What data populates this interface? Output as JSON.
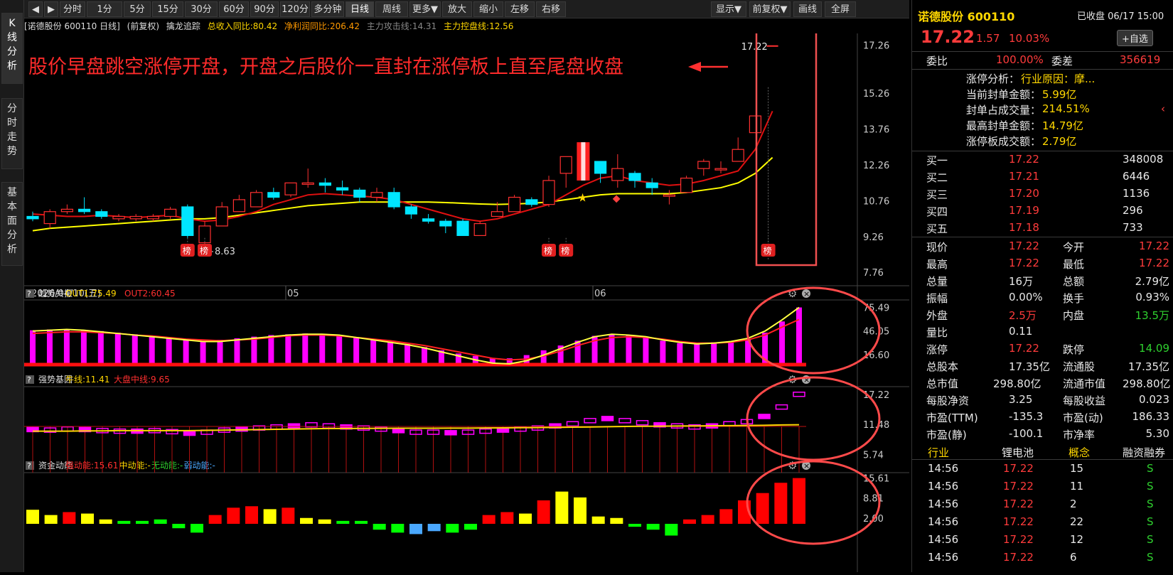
{
  "left_tabs": [
    "K线分析",
    "分时走势",
    "基本面分析"
  ],
  "toolbar": {
    "buttons": [
      "分时",
      "1分",
      "5分",
      "15分",
      "30分",
      "60分",
      "90分",
      "120分",
      "多分钟",
      "日线",
      "周线",
      "更多▼",
      "放大",
      "缩小",
      "左移",
      "右移"
    ],
    "selected": "日线",
    "right_buttons": [
      "显示▼",
      "前复权▼",
      "画线",
      "全屏"
    ]
  },
  "chart_header": {
    "title": "[诺德股份 600110 日线]",
    "adjust": "(前复权)",
    "indicator": "擒龙追踪",
    "rev": "总收入同比:80.42",
    "profit": "净利润同比:206.42",
    "attack": "主力攻击线:14.31",
    "control": "主力控盘线:12.56"
  },
  "annotation": "股价早盘跳空涨停开盘，开盘之后股价一直封在涨停板上直至尾盘收盘",
  "price_axis": [
    "17.26",
    "15.26",
    "13.76",
    "12.26",
    "10.76",
    "9.26",
    "7.76"
  ],
  "date_axis": [
    "2026/04/10(五)",
    "05",
    "06"
  ],
  "last_price_label": "17.22",
  "low_label": "8.63",
  "bang": "榜",
  "panel1": {
    "name": "趋势共振",
    "out1": "OUT1:75.49",
    "out2": "OUT2:60.45",
    "ticks": [
      "75.49",
      "46.05",
      "16.60"
    ]
  },
  "panel2": {
    "name": "强势基因",
    "l1": "牛线:11.41",
    "l2": "大盘中线:9.65",
    "ticks": [
      "17.22",
      "11.48",
      "5.74"
    ]
  },
  "panel3": {
    "name": "资金动能",
    "l1": "强动能:15.61",
    "l2": "中动能:-",
    "l3": "无动能:-",
    "l4": "弱动能:-",
    "ticks": [
      "15.61",
      "8.81",
      "2.00"
    ]
  },
  "chart_data": {
    "type": "candlestick",
    "candles": [
      [
        10.1,
        10.0,
        10.3,
        9.9
      ],
      [
        9.8,
        10.3,
        10.4,
        9.6
      ],
      [
        10.3,
        10.4,
        10.6,
        10.2
      ],
      [
        10.4,
        10.3,
        10.9,
        10.2
      ],
      [
        10.3,
        10.1,
        10.4,
        10.0
      ],
      [
        10.0,
        10.1,
        10.2,
        9.9
      ],
      [
        10.0,
        10.1,
        10.2,
        9.9
      ],
      [
        10.0,
        10.1,
        10.2,
        9.9
      ],
      [
        10.1,
        10.4,
        10.5,
        10.0
      ],
      [
        10.5,
        9.3,
        10.6,
        9.2
      ],
      [
        9.0,
        9.7,
        9.9,
        8.63
      ],
      [
        9.7,
        10.5,
        10.7,
        9.7
      ],
      [
        10.3,
        10.8,
        11.0,
        10.3
      ],
      [
        10.5,
        11.1,
        11.2,
        10.5
      ],
      [
        11.1,
        10.9,
        11.3,
        10.8
      ],
      [
        11.0,
        11.5,
        11.5,
        10.9
      ],
      [
        11.5,
        11.5,
        12.1,
        11.3
      ],
      [
        11.5,
        11.4,
        11.7,
        11.1
      ],
      [
        11.3,
        11.2,
        11.6,
        11.0
      ],
      [
        11.2,
        10.9,
        11.3,
        10.7
      ],
      [
        10.9,
        11.1,
        11.3,
        10.7
      ],
      [
        11.1,
        10.5,
        11.3,
        10.4
      ],
      [
        10.5,
        10.2,
        10.6,
        10.0
      ],
      [
        10.0,
        9.9,
        10.2,
        9.8
      ],
      [
        9.9,
        9.7,
        10.0,
        9.4
      ],
      [
        9.9,
        9.3,
        10.0,
        9.3
      ],
      [
        9.3,
        9.8,
        9.9,
        9.3
      ],
      [
        10.1,
        10.3,
        10.7,
        10.1
      ],
      [
        10.3,
        10.9,
        11.0,
        10.3
      ],
      [
        10.8,
        10.6,
        10.9,
        10.5
      ],
      [
        10.6,
        11.6,
        11.8,
        10.5
      ],
      [
        11.9,
        12.6,
        12.6,
        11.3
      ],
      [
        12.7,
        12.4,
        13.1,
        12.3
      ],
      [
        12.4,
        11.9,
        12.4,
        11.5
      ],
      [
        11.6,
        12.1,
        12.7,
        11.3
      ],
      [
        11.9,
        11.6,
        12.0,
        11.3
      ],
      [
        11.5,
        11.3,
        11.7,
        11.0
      ],
      [
        11.0,
        11.0,
        11.2,
        10.6
      ],
      [
        11.1,
        11.7,
        11.8,
        11.1
      ],
      [
        12.1,
        12.4,
        12.5,
        11.8
      ],
      [
        12.1,
        12.1,
        12.4,
        11.9
      ],
      [
        12.4,
        12.9,
        13.4,
        12.4
      ],
      [
        13.6,
        14.3,
        14.3,
        13.6
      ],
      [
        17.22,
        17.22,
        17.22,
        17.22
      ]
    ],
    "ma_red": [
      10.2,
      10.15,
      10.1,
      10.1,
      10.15,
      10.1,
      10.05,
      10.1,
      10.15,
      10.0,
      9.9,
      9.95,
      10.1,
      10.3,
      10.6,
      10.8,
      11.0,
      11.05,
      11.0,
      10.95,
      10.9,
      10.8,
      10.6,
      10.4,
      10.2,
      10.0,
      9.9,
      10.0,
      10.2,
      10.4,
      10.6,
      11.0,
      11.4,
      11.7,
      11.8,
      11.6,
      11.5,
      11.4,
      11.45,
      11.6,
      11.8,
      12.0,
      12.9,
      14.5
    ],
    "ma_yellow": [
      9.5,
      9.6,
      9.65,
      9.7,
      9.75,
      9.8,
      9.85,
      9.9,
      9.95,
      10.0,
      10.0,
      10.05,
      10.15,
      10.25,
      10.35,
      10.45,
      10.55,
      10.6,
      10.65,
      10.7,
      10.7,
      10.7,
      10.7,
      10.7,
      10.68,
      10.65,
      10.62,
      10.6,
      10.62,
      10.65,
      10.7,
      10.8,
      10.9,
      11.0,
      11.05,
      11.05,
      11.05,
      11.05,
      11.1,
      11.2,
      11.3,
      11.5,
      11.9,
      12.56
    ],
    "osc_bars": [
      47,
      48,
      48,
      47,
      46,
      44,
      42,
      40,
      38,
      36,
      34,
      35,
      37,
      39,
      41,
      42,
      43,
      42,
      40,
      38,
      36,
      33,
      30,
      26,
      22,
      18,
      15,
      12,
      12,
      16,
      22,
      28,
      34,
      40,
      42,
      41,
      38,
      34,
      31,
      31,
      32,
      33,
      36,
      44,
      58,
      75.49
    ],
    "osc_out1": [
      46,
      47,
      48,
      47,
      45,
      43,
      41,
      39,
      37,
      35,
      33,
      33,
      35,
      37,
      39,
      41,
      42,
      42,
      41,
      38,
      35,
      32,
      29,
      25,
      20,
      15,
      10,
      6,
      5,
      9,
      16,
      24,
      32,
      39,
      42,
      41,
      39,
      35,
      32,
      30,
      31,
      33,
      37,
      46,
      60,
      75.49
    ],
    "osc_out2": [
      43,
      44,
      45,
      45,
      44,
      43,
      41,
      40,
      38,
      36,
      35,
      34,
      35,
      36,
      38,
      40,
      41,
      41,
      40,
      38,
      36,
      34,
      31,
      28,
      24,
      20,
      16,
      12,
      10,
      11,
      15,
      21,
      28,
      34,
      38,
      39,
      38,
      36,
      33,
      31,
      31,
      32,
      35,
      41,
      51,
      60.45
    ],
    "gene_vals": [
      10.5,
      10.4,
      10.6,
      10.5,
      10.3,
      10.2,
      10.2,
      10.3,
      10.1,
      9.8,
      10.0,
      10.4,
      10.6,
      10.8,
      11.0,
      11.2,
      11.4,
      11.2,
      11.0,
      10.8,
      10.6,
      10.3,
      10.0,
      10.0,
      9.9,
      10.0,
      10.2,
      10.4,
      10.6,
      10.8,
      11.2,
      11.6,
      12.2,
      12.6,
      12.2,
      11.8,
      11.4,
      11.2,
      11.0,
      11.2,
      11.6,
      12.0,
      13.0,
      14.8,
      17.22
    ],
    "gene_line": [
      10.2,
      10.2,
      10.2,
      10.25,
      10.25,
      10.3,
      10.3,
      10.3,
      10.3,
      10.3,
      10.35,
      10.4,
      10.45,
      10.5,
      10.55,
      10.6,
      10.65,
      10.7,
      10.7,
      10.72,
      10.74,
      10.75,
      10.75,
      10.76,
      10.77,
      10.78,
      10.8,
      10.82,
      10.85,
      10.88,
      10.9,
      10.95,
      11.0,
      11.05,
      11.1,
      11.12,
      11.15,
      11.18,
      11.2,
      11.22,
      11.25,
      11.28,
      11.32,
      11.38,
      11.41
    ],
    "money_vals": [
      4.8,
      3.0,
      4.0,
      3.5,
      1.5,
      1.0,
      1.0,
      1.5,
      -1.5,
      -3.0,
      3.0,
      5.5,
      6.0,
      5.0,
      5.5,
      2.0,
      1.5,
      1.0,
      1.0,
      -2.0,
      -3.0,
      -3.5,
      -2.5,
      -3.0,
      -2.0,
      3.0,
      4.0,
      3.5,
      8.0,
      11.0,
      9.0,
      2.5,
      2.0,
      -1.0,
      -2.0,
      -4.0,
      1.5,
      3.0,
      5.0,
      8.0,
      10.5,
      14.0,
      15.61
    ],
    "money_colors": [
      "#ffff00",
      "#ffff00",
      "#ff0000",
      "#ffff00",
      "#ffff00",
      "#00ff00",
      "#00ff00",
      "#00ff00",
      "#00ff00",
      "#00ff00",
      "#ff0000",
      "#ff0000",
      "#ff0000",
      "#ffff00",
      "#ff0000",
      "#ffff00",
      "#ffff00",
      "#00ff00",
      "#00ff00",
      "#00ff00",
      "#00ff00",
      "#4aa8ff",
      "#4aa8ff",
      "#00ff00",
      "#00ff00",
      "#ff0000",
      "#ff0000",
      "#ffff00",
      "#ff0000",
      "#ffff00",
      "#ffff00",
      "#ffff00",
      "#ffff00",
      "#00ff00",
      "#00ff00",
      "#00ff00",
      "#ff0000",
      "#ff0000",
      "#ff0000",
      "#ff0000",
      "#ff0000",
      "#ff0000",
      "#ff0000"
    ]
  },
  "quote": {
    "name": "诺德股份 600110",
    "status": "已收盘 06/17 15:00",
    "price": "17.22",
    "change": "1.57",
    "pct": "10.03%",
    "watch": "+自选",
    "weibi_l": "委比",
    "weibi": "100.00%",
    "weicha_l": "委差",
    "weicha": "356619",
    "ls": [
      [
        "涨停分析：",
        "行业原因：摩..."
      ],
      [
        "当前封单金额：",
        "5.99亿"
      ],
      [
        "封单占成交量：",
        "214.51%"
      ],
      [
        "最高封单金额：",
        "14.79亿"
      ],
      [
        "涨停板成交额：",
        "2.79亿"
      ]
    ],
    "bids": [
      [
        "买一",
        "17.22",
        "348008"
      ],
      [
        "买二",
        "17.21",
        "6446"
      ],
      [
        "买三",
        "17.20",
        "1136"
      ],
      [
        "买四",
        "17.19",
        "296"
      ],
      [
        "买五",
        "17.18",
        "733"
      ]
    ],
    "stats": [
      [
        "现价",
        "17.22",
        "今开",
        "17.22"
      ],
      [
        "最高",
        "17.22",
        "最低",
        "17.22"
      ],
      [
        "总量",
        "16万",
        "总额",
        "2.79亿"
      ],
      [
        "振幅",
        "0.00%",
        "换手",
        "0.93%"
      ],
      [
        "外盘",
        "2.5万",
        "内盘",
        "13.5万"
      ],
      [
        "量比",
        "0.11",
        "",
        ""
      ],
      [
        "涨停",
        "17.22",
        "跌停",
        "14.09"
      ],
      [
        "总股本",
        "17.35亿",
        "流通股",
        "17.35亿"
      ],
      [
        "总市值",
        "298.80亿",
        "流通市值",
        "298.80亿"
      ],
      [
        "每股净资",
        "3.25",
        "每股收益",
        "0.023"
      ],
      [
        "市盈(TTM)",
        "-135.3",
        "市盈(动)",
        "186.33"
      ],
      [
        "市盈(静)",
        "-100.1",
        "市净率",
        "5.30"
      ]
    ],
    "tags": [
      "行业",
      "锂电池",
      "概念",
      "融资融券"
    ],
    "ticks": [
      [
        "14:56",
        "17.22",
        "15",
        "S"
      ],
      [
        "14:56",
        "17.22",
        "11",
        "S"
      ],
      [
        "14:56",
        "17.22",
        "2",
        "S"
      ],
      [
        "14:56",
        "17.22",
        "22",
        "S"
      ],
      [
        "14:56",
        "17.22",
        "12",
        "S"
      ],
      [
        "14:56",
        "17.22",
        "6",
        "S"
      ]
    ]
  }
}
